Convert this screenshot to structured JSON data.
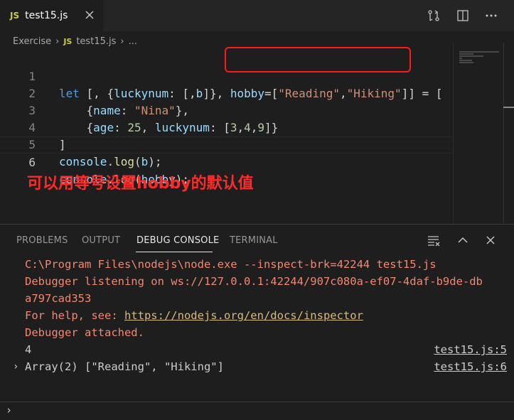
{
  "tab": {
    "badge": "JS",
    "title": "test15.js"
  },
  "breadcrumb": {
    "folder": "Exercise",
    "badge": "JS",
    "file": "test15.js",
    "more": "..."
  },
  "editor": {
    "lines": [
      {
        "number": "1"
      },
      {
        "number": "2"
      },
      {
        "number": "3"
      },
      {
        "number": "4"
      },
      {
        "number": "5"
      },
      {
        "number": "6"
      }
    ],
    "tokens": {
      "l1_let": "let",
      "l1_a": " [, {",
      "l1_lucky": "luckynum",
      "l1_b": ": [,",
      "l1_bvar": "b",
      "l1_c": "]}, ",
      "l1_hobby": "hobby",
      "l1_eq": "=[",
      "l1_s1": "\"Reading\"",
      "l1_comma": ",",
      "l1_s2": "\"Hiking\"",
      "l1_end": "]] = [",
      "l2_a": "    {",
      "l2_name": "name",
      "l2_b": ": ",
      "l2_s": "\"Nina\"",
      "l2_c": "},",
      "l3_a": "    {",
      "l3_age": "age",
      "l3_b": ": ",
      "l3_n": "25",
      "l3_c": ", ",
      "l3_lucky": "luckynum",
      "l3_d": ": [",
      "l3_n1": "3",
      "l3_e": ",",
      "l3_n2": "4",
      "l3_f": ",",
      "l3_n3": "9",
      "l3_g": "]}",
      "l4": "]",
      "l5_console": "console",
      "l5_dot": ".",
      "l5_log": "log",
      "l5_a": "(",
      "l5_b": "b",
      "l5_c": ");",
      "l6_console": "console",
      "l6_dot": ".",
      "l6_log": "log",
      "l6_a": "(",
      "l6_b": "hobby",
      "l6_c": ");"
    },
    "annotation": "可以用等号设置hobby的默认值"
  },
  "panel": {
    "tabs": [
      "PROBLEMS",
      "OUTPUT",
      "DEBUG CONSOLE",
      "TERMINAL"
    ],
    "active_tab": "DEBUG CONSOLE",
    "console": {
      "cmd": "C:\\Program Files\\nodejs\\node.exe --inspect-brk=42244 test15.js",
      "listen1": "Debugger listening on ws://127.0.0.1:42244/907c080a-ef07-4daf-b9de-db",
      "listen2": "a797cad353",
      "help_prefix": "For help, see: ",
      "help_link": "https://nodejs.org/en/docs/inspector",
      "attached": "Debugger attached.",
      "out1": "4",
      "out1_src": "test15.js:5",
      "out2_expand": "›",
      "out2": "Array(2) [\"Reading\", \"Hiking\"]",
      "out2_src": "test15.js:6"
    },
    "prompt": "›"
  },
  "colors": {
    "keyword": "#569cd6",
    "string": "#ce9178",
    "number": "#b5cea8",
    "property": "#9cdcfe",
    "function": "#dcdcaa",
    "annotation": "#ff2a2a",
    "console_info": "#f48771",
    "link": "#d7ba7d"
  }
}
